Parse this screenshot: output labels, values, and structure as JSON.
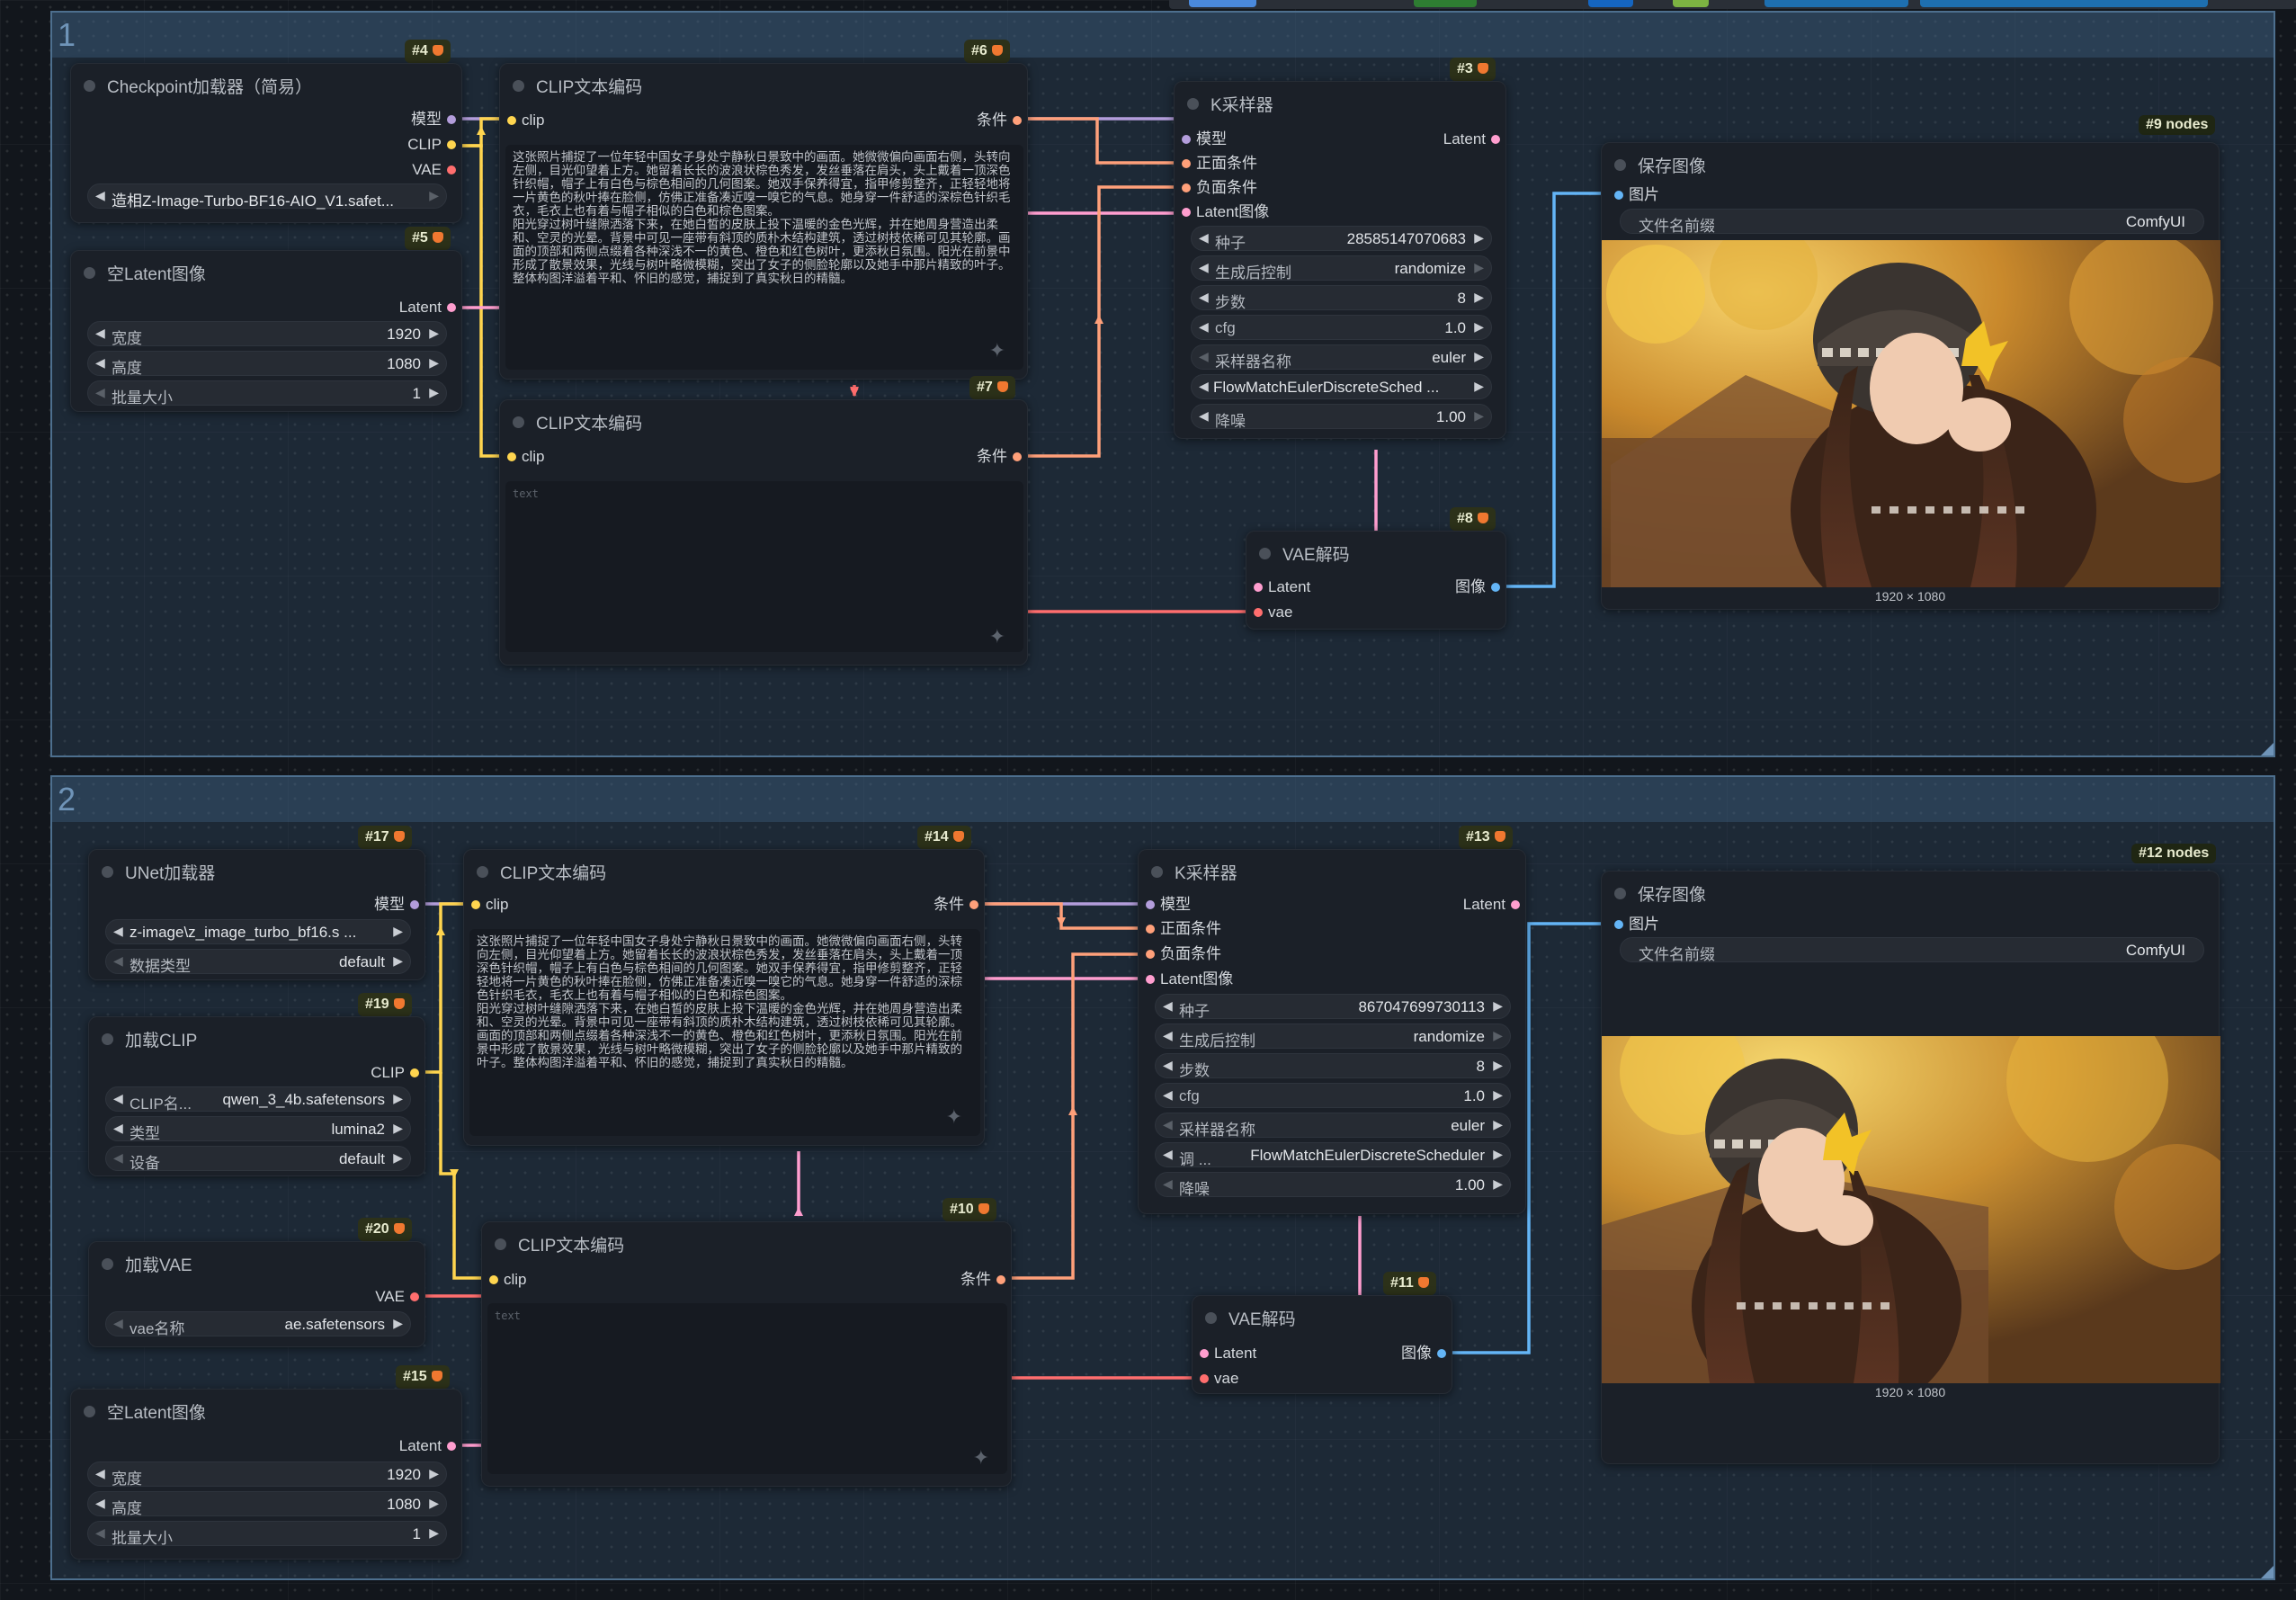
{
  "groups": [
    {
      "title": "1",
      "node_count_label": "#9 nodes"
    },
    {
      "title": "2",
      "node_count_label": "#12 nodes"
    }
  ],
  "colors": {
    "model": "#b39ddb",
    "clip": "#ffd54f",
    "vae": "#ff6e6e",
    "conditioning": "#ffa07a",
    "latent": "#ff9ecf",
    "image": "#64b5f6"
  },
  "g1": {
    "checkpoint": {
      "id": "#4",
      "title": "Checkpoint加载器（简易）",
      "out_model": "模型",
      "out_clip": "CLIP",
      "out_vae": "VAE",
      "ckpt_name": "造相Z-Image-Turbo-BF16-AIO_V1.safet..."
    },
    "clip_pos": {
      "id": "#6",
      "title": "CLIP文本编码",
      "in_clip": "clip",
      "out": "条件",
      "text": "这张照片捕捉了一位年轻中国女子身处宁静秋日景致中的画面。她微微偏向画面右侧，头转向左侧，目光仰望着上方。她留着长长的波浪状棕色秀发，发丝垂落在肩头，头上戴着一顶深色针织帽，帽子上有白色与棕色相间的几何图案。她双手保养得宜，指甲修剪整齐，正轻轻地将一片黄色的秋叶捧在脸侧，仿佛正准备凑近嗅一嗅它的气息。她身穿一件舒适的深棕色针织毛衣，毛衣上也有着与帽子相似的白色和棕色图案。\n阳光穿过树叶缝隙洒落下来，在她白皙的皮肤上投下温暖的金色光辉，并在她周身营造出柔和、空灵的光晕。背景中可见一座带有斜顶的质朴木结构建筑，透过树枝依稀可见其轮廓。画面的顶部和两侧点缀着各种深浅不一的黄色、橙色和红色树叶，更添秋日氛围。阳光在前景中形成了散景效果，光线与树叶略微模糊，突出了女子的侧脸轮廓以及她手中那片精致的叶子。整体构图洋溢着平和、怀旧的感觉，捕捉到了真实秋日的精髓。"
    },
    "empty_latent": {
      "id": "#5",
      "title": "空Latent图像",
      "out": "Latent",
      "width_label": "宽度",
      "width": "1920",
      "height_label": "高度",
      "height": "1080",
      "batch_label": "批量大小",
      "batch": "1"
    },
    "clip_neg": {
      "id": "#7",
      "title": "CLIP文本编码",
      "in_clip": "clip",
      "out": "条件",
      "placeholder": "text"
    },
    "ksampler": {
      "id": "#3",
      "title": "K采样器",
      "in_model": "模型",
      "in_pos": "正面条件",
      "in_neg": "负面条件",
      "in_latent": "Latent图像",
      "out": "Latent",
      "widgets": [
        {
          "name": "种子",
          "value": "28585147070683"
        },
        {
          "name": "生成后控制",
          "value": "randomize"
        },
        {
          "name": "步数",
          "value": "8"
        },
        {
          "name": "cfg",
          "value": "1.0"
        },
        {
          "name": "采样器名称",
          "value": "euler"
        },
        {
          "name": "",
          "value": "FlowMatchEulerDiscreteSched ..."
        },
        {
          "name": "降噪",
          "value": "1.00"
        }
      ]
    },
    "vae_decode": {
      "id": "#8",
      "title": "VAE解码",
      "in_latent": "Latent",
      "in_vae": "vae",
      "out": "图像"
    },
    "save": {
      "title": "保存图像",
      "in_images": "图片",
      "prefix_label": "文件名前缀",
      "prefix": "ComfyUI",
      "size": "1920 × 1080"
    }
  },
  "g2": {
    "unet": {
      "id": "#17",
      "title": "UNet加载器",
      "out_model": "模型",
      "unet_name": "z-image\\z_image_turbo_bf16.s ...",
      "dtype_label": "数据类型",
      "dtype": "default"
    },
    "clip_loader": {
      "id": "#19",
      "title": "加载CLIP",
      "out_clip": "CLIP",
      "clip_name_label": "CLIP名...",
      "clip_name": "qwen_3_4b.safetensors",
      "type_label": "类型",
      "type": "lumina2",
      "device_label": "设备",
      "device": "default"
    },
    "vae_loader": {
      "id": "#20",
      "title": "加载VAE",
      "out_vae": "VAE",
      "vae_name_label": "vae名称",
      "vae_name": "ae.safetensors"
    },
    "empty_latent": {
      "id": "#15",
      "title": "空Latent图像",
      "out": "Latent",
      "width_label": "宽度",
      "width": "1920",
      "height_label": "高度",
      "height": "1080",
      "batch_label": "批量大小",
      "batch": "1"
    },
    "clip_pos": {
      "id": "#14",
      "title": "CLIP文本编码",
      "in_clip": "clip",
      "out": "条件",
      "text": "这张照片捕捉了一位年轻中国女子身处宁静秋日景致中的画面。她微微偏向画面右侧，头转向左侧，目光仰望着上方。她留着长长的波浪状棕色秀发，发丝垂落在肩头，头上戴着一顶深色针织帽，帽子上有白色与棕色相间的几何图案。她双手保养得宜，指甲修剪整齐，正轻轻地将一片黄色的秋叶捧在脸侧，仿佛正准备凑近嗅一嗅它的气息。她身穿一件舒适的深棕色针织毛衣，毛衣上也有着与帽子相似的白色和棕色图案。\n阳光穿过树叶缝隙洒落下来，在她白皙的皮肤上投下温暖的金色光辉，并在她周身营造出柔和、空灵的光晕。背景中可见一座带有斜顶的质朴木结构建筑，透过树枝依稀可见其轮廓。画面的顶部和两侧点缀着各种深浅不一的黄色、橙色和红色树叶，更添秋日氛围。阳光在前景中形成了散景效果，光线与树叶略微模糊，突出了女子的侧脸轮廓以及她手中那片精致的叶子。整体构图洋溢着平和、怀旧的感觉，捕捉到了真实秋日的精髓。"
    },
    "clip_neg": {
      "id": "#10",
      "title": "CLIP文本编码",
      "in_clip": "clip",
      "out": "条件",
      "placeholder": "text"
    },
    "ksampler": {
      "id": "#13",
      "title": "K采样器",
      "in_model": "模型",
      "in_pos": "正面条件",
      "in_neg": "负面条件",
      "in_latent": "Latent图像",
      "out": "Latent",
      "widgets": [
        {
          "name": "种子",
          "value": "867047699730113"
        },
        {
          "name": "生成后控制",
          "value": "randomize"
        },
        {
          "name": "步数",
          "value": "8"
        },
        {
          "name": "cfg",
          "value": "1.0"
        },
        {
          "name": "采样器名称",
          "value": "euler"
        },
        {
          "name": "调 ...",
          "value": "FlowMatchEulerDiscreteScheduler"
        },
        {
          "name": "降噪",
          "value": "1.00"
        }
      ]
    },
    "vae_decode": {
      "id": "#11",
      "title": "VAE解码",
      "in_latent": "Latent",
      "in_vae": "vae",
      "out": "图像"
    },
    "save": {
      "title": "保存图像",
      "in_images": "图片",
      "prefix_label": "文件名前缀",
      "prefix": "ComfyUI",
      "size": "1920 × 1080"
    }
  }
}
